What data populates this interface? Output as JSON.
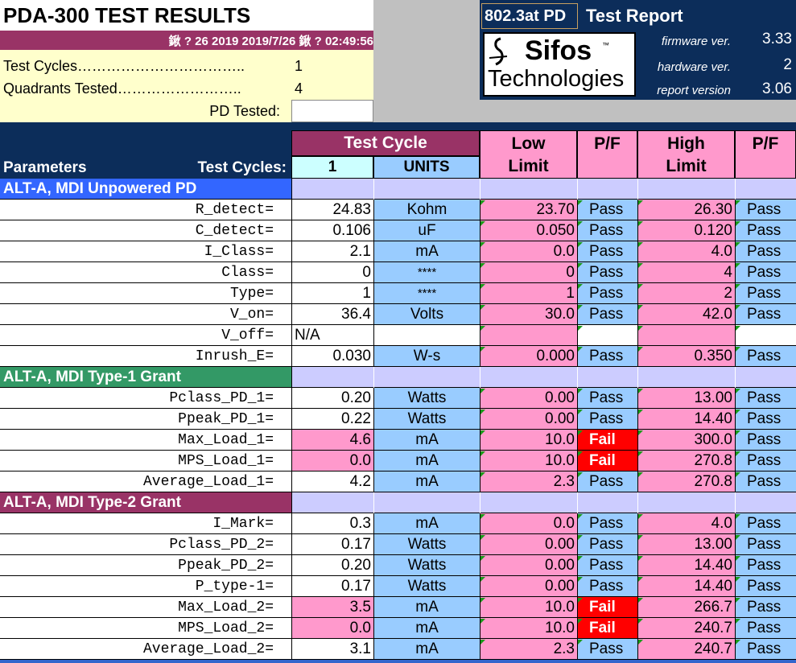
{
  "header": {
    "title": "PDA-300 TEST RESULTS",
    "datetime": "鍬  ? 26 2019  2019/7/26 鍬   ? 02:49:56",
    "test_cycles_label": "Test Cycles……………………………..",
    "test_cycles_value": "1",
    "quadrants_label": "Quadrants Tested……………………..",
    "quadrants_value": "4",
    "pd_tested_label": "PD Tested:",
    "pd_tested_value": ""
  },
  "report": {
    "standard": "802.3at PD",
    "title": "Test Report",
    "logo_name": "Sifos",
    "logo_tm": "™",
    "logo_sub": "Technologies",
    "firmware_label": "firmware ver.",
    "firmware_value": "3.33",
    "hardware_label": "hardware ver.",
    "hardware_value": "2",
    "report_label": "report version",
    "report_value": "3.06"
  },
  "columns": {
    "parameters": "Parameters",
    "test_cycles": "Test Cycles:",
    "test_cycle": "Test Cycle",
    "cycle_num": "1",
    "units": "UNITS",
    "low_top": "Low",
    "low_bottom": "Limit",
    "pf1": "P/F",
    "high_top": "High",
    "high_bottom": "Limit",
    "pf2": "P/F"
  },
  "sections": [
    {
      "title": "ALT-A, MDI Unpowered PD",
      "color": "#3366ff",
      "rows": [
        {
          "param": "R_detect=",
          "value": "24.83",
          "unit": "Kohm",
          "low": "23.70",
          "pf1": "Pass",
          "high": "26.30",
          "pf2": "Pass"
        },
        {
          "param": "C_detect=",
          "value": "0.106",
          "unit": "uF",
          "low": "0.050",
          "pf1": "Pass",
          "high": "0.120",
          "pf2": "Pass"
        },
        {
          "param": "I_Class=",
          "value": "2.1",
          "unit": "mA",
          "low": "0.0",
          "pf1": "Pass",
          "high": "4.0",
          "pf2": "Pass"
        },
        {
          "param": "Class=",
          "value": "0",
          "unit": "****",
          "low": "0",
          "pf1": "Pass",
          "high": "4",
          "pf2": "Pass"
        },
        {
          "param": "Type=",
          "value": "1",
          "unit": "****",
          "low": "1",
          "pf1": "Pass",
          "high": "2",
          "pf2": "Pass"
        },
        {
          "param": "V_on=",
          "value": "36.4",
          "unit": "Volts",
          "low": "30.0",
          "pf1": "Pass",
          "high": "42.0",
          "pf2": "Pass"
        },
        {
          "param": "V_off=",
          "value": "N/A",
          "unit": "",
          "low": "",
          "pf1": "",
          "high": "",
          "pf2": "",
          "na": true
        },
        {
          "param": "Inrush_E=",
          "value": "0.030",
          "unit": "W-s",
          "low": "0.000",
          "pf1": "Pass",
          "high": "0.350",
          "pf2": "Pass"
        }
      ]
    },
    {
      "title": "ALT-A, MDI Type-1 Grant",
      "color": "#339966",
      "rows": [
        {
          "param": "Pclass_PD_1=",
          "value": "0.20",
          "unit": "Watts",
          "low": "0.00",
          "pf1": "Pass",
          "high": "13.00",
          "pf2": "Pass"
        },
        {
          "param": "Ppeak_PD_1=",
          "value": "0.22",
          "unit": "Watts",
          "low": "0.00",
          "pf1": "Pass",
          "high": "14.40",
          "pf2": "Pass"
        },
        {
          "param": "Max_Load_1=",
          "value": "4.6",
          "unit": "mA",
          "low": "10.0",
          "pf1": "Fail",
          "high": "300.0",
          "pf2": "Pass",
          "fail": true
        },
        {
          "param": "MPS_Load_1=",
          "value": "0.0",
          "unit": "mA",
          "low": "10.0",
          "pf1": "Fail",
          "high": "270.8",
          "pf2": "Pass",
          "fail": true
        },
        {
          "param": "Average_Load_1=",
          "value": "4.2",
          "unit": "mA",
          "low": "2.3",
          "pf1": "Pass",
          "high": "270.8",
          "pf2": "Pass"
        }
      ]
    },
    {
      "title": "ALT-A, MDI Type-2 Grant",
      "color": "#993366",
      "rows": [
        {
          "param": "I_Mark=",
          "value": "0.3",
          "unit": "mA",
          "low": "0.0",
          "pf1": "Pass",
          "high": "4.0",
          "pf2": "Pass"
        },
        {
          "param": "Pclass_PD_2=",
          "value": "0.17",
          "unit": "Watts",
          "low": "0.00",
          "pf1": "Pass",
          "high": "13.00",
          "pf2": "Pass"
        },
        {
          "param": "Ppeak_PD_2=",
          "value": "0.20",
          "unit": "Watts",
          "low": "0.00",
          "pf1": "Pass",
          "high": "14.40",
          "pf2": "Pass"
        },
        {
          "param": "P_type-1=",
          "value": "0.17",
          "unit": "Watts",
          "low": "0.00",
          "pf1": "Pass",
          "high": "14.40",
          "pf2": "Pass"
        },
        {
          "param": "Max_Load_2=",
          "value": "3.5",
          "unit": "mA",
          "low": "10.0",
          "pf1": "Fail",
          "high": "266.7",
          "pf2": "Pass",
          "fail": true
        },
        {
          "param": "MPS_Load_2=",
          "value": "0.0",
          "unit": "mA",
          "low": "10.0",
          "pf1": "Fail",
          "high": "240.7",
          "pf2": "Pass",
          "fail": true
        },
        {
          "param": "Average_Load_2=",
          "value": "3.1",
          "unit": "mA",
          "low": "2.3",
          "pf1": "Pass",
          "high": "240.7",
          "pf2": "Pass"
        }
      ]
    }
  ],
  "colors": {
    "navy": "#0c2d5a",
    "maroon": "#993366",
    "cream": "#ffffcc",
    "gray": "#c0c0c0",
    "light_blue": "#99ccff",
    "cyan_light": "#ccffff",
    "pink": "#ff99cc",
    "lavender": "#ccccff",
    "fail_red": "#ff0000"
  }
}
